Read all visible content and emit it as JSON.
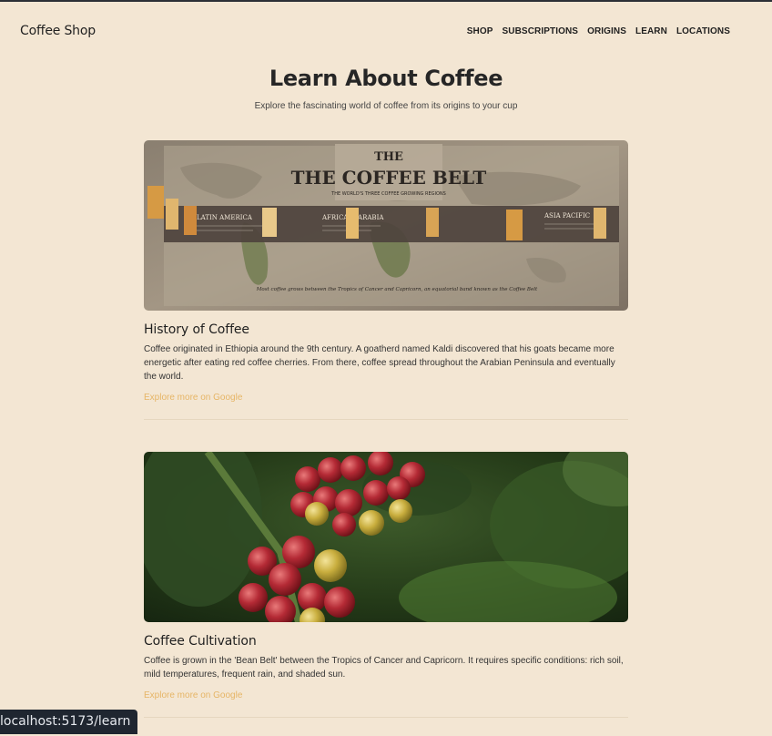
{
  "brand": "Coffee Shop",
  "nav": {
    "items": [
      "SHOP",
      "SUBSCRIPTIONS",
      "ORIGINS",
      "LEARN",
      "LOCATIONS"
    ]
  },
  "hero": {
    "title": "Learn About Coffee",
    "subtitle": "Explore the fascinating world of coffee from its origins to your cup"
  },
  "articles": [
    {
      "image_alt": "The Coffee Belt map",
      "image_text": {
        "title": "THE COFFEE BELT",
        "subtitle": "THE WORLD'S THREE COFFEE GROWING REGIONS",
        "region_1": "LATIN AMERICA",
        "region_2": "AFRICA & ARABIA",
        "region_3": "ASIA PACIFIC",
        "caption": "Most coffee grows between the Tropics of Cancer and Capricorn, an equatorial band known as the Coffee Belt"
      },
      "title": "History of Coffee",
      "body": "Coffee originated in Ethiopia around the 9th century. A goatherd named Kaldi discovered that his goats became more energetic after eating red coffee cherries. From there, coffee spread throughout the Arabian Peninsula and eventually the world.",
      "link": "Explore more on Google"
    },
    {
      "image_alt": "Coffee cherries on branch",
      "title": "Coffee Cultivation",
      "body": "Coffee is grown in the 'Bean Belt' between the Tropics of Cancer and Capricorn. It requires specific conditions: rich soil, mild temperatures, frequent rain, and shaded sun.",
      "link": "Explore more on Google"
    }
  ],
  "status_bar": {
    "url": "localhost:5173/learn"
  },
  "colors": {
    "background": "#f3e6d3",
    "link": "#e6b566",
    "text": "#222222"
  }
}
